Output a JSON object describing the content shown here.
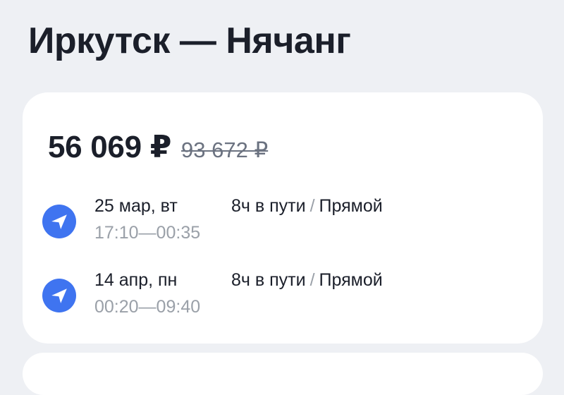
{
  "route": {
    "title": "Иркутск — Нячанг"
  },
  "offer": {
    "price": "56 069 ₽",
    "old_price": "93 672 ₽"
  },
  "segments": [
    {
      "date": "25 мар, вт",
      "time": "17:10—00:35",
      "duration": "8ч в пути",
      "separator": "/",
      "type": "Прямой",
      "icon": "plane-icon"
    },
    {
      "date": "14 апр, пн",
      "time": "00:20—09:40",
      "duration": "8ч в пути",
      "separator": "/",
      "type": "Прямой",
      "icon": "plane-icon"
    }
  ],
  "colors": {
    "background": "#eef0f4",
    "card": "#ffffff",
    "accent": "#3f74f0",
    "muted_text": "#9aa0a8"
  }
}
